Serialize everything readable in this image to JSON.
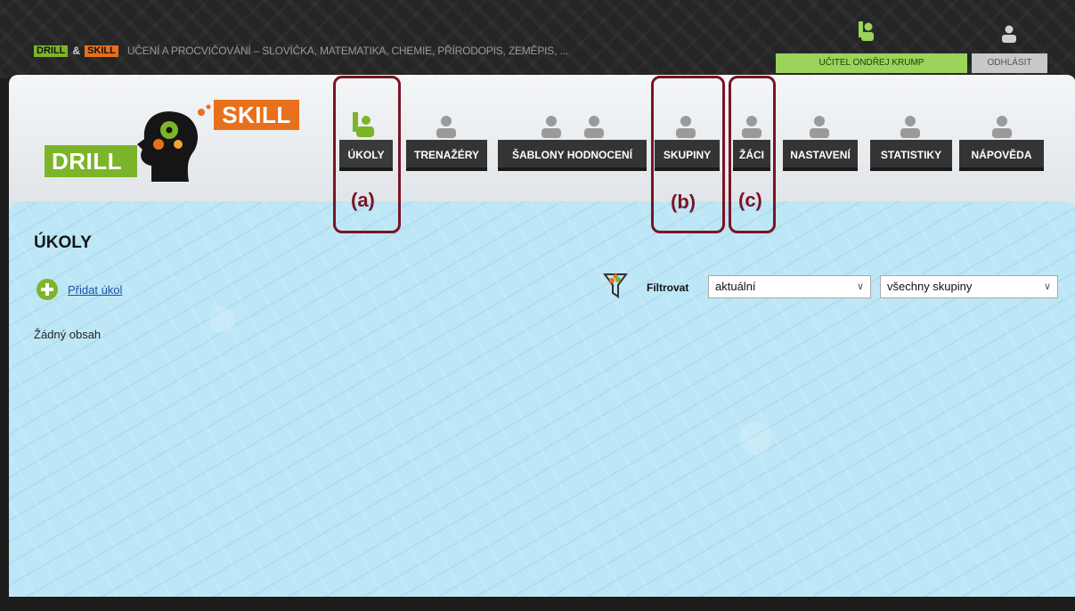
{
  "topbar": {
    "drill_chip": "DRILL",
    "amp": "&",
    "skill_chip": "SKILL",
    "tagline": "UČENÍ A PROCVIČOVÁNÍ – SLOVÍČKA, MATEMATIKA, CHEMIE, PŘÍRODOPIS, ZEMĚPIS, ...",
    "teacher_label": "UČITEL ONDŘEJ KRUMP",
    "logout_label": "ODHLÁSIT"
  },
  "logo": {
    "skill": "SKILL",
    "drill": "DRILL"
  },
  "nav": {
    "tabs": [
      {
        "label": "ÚKOLY"
      },
      {
        "label": "TRENAŽÉRY"
      },
      {
        "label": "ŠABLONY HODNOCENÍ"
      },
      {
        "label": "SKUPINY"
      },
      {
        "label": "ŽÁCI"
      },
      {
        "label": "NASTAVENÍ"
      },
      {
        "label": "STATISTIKY"
      },
      {
        "label": "NÁPOVĚDA"
      }
    ]
  },
  "annotations": {
    "a": "(a)",
    "b": "(b)",
    "c": "(c)"
  },
  "main": {
    "title": "ÚKOLY",
    "add_task": "Přidat úkol",
    "empty": "Žádný obsah",
    "filter_label": "Filtrovat",
    "filter_status": "aktuální",
    "filter_group": "všechny skupiny"
  },
  "colors": {
    "accent_green": "#7cb52a",
    "accent_orange": "#e8701c",
    "annotation": "#7a1426",
    "panel_blue": "#bde6f6",
    "nav_dark": "#343434"
  },
  "icons": [
    "person-icon",
    "person-active-icon",
    "plus-circle-icon",
    "filter-funnel-icon",
    "chevron-down-icon",
    "head-gears-icon"
  ]
}
